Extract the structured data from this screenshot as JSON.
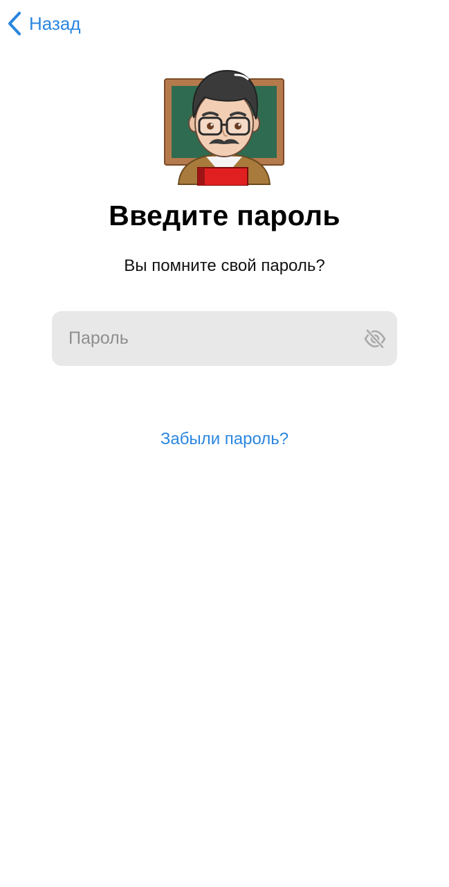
{
  "nav": {
    "back_label": "Назад",
    "back_icon": "chevron-left-icon"
  },
  "illustration": {
    "icon": "teacher-emoji"
  },
  "heading": {
    "title": "Введите пароль",
    "subtitle": "Вы помните свой пароль?"
  },
  "password": {
    "placeholder": "Пароль",
    "value": "",
    "toggle_icon": "eye-slash-icon"
  },
  "links": {
    "forgot_password": "Забыли пароль?"
  },
  "colors": {
    "accent": "#2a86df",
    "field_background": "#e8e8e8",
    "placeholder": "#8e8e8e",
    "background": "#ffffff"
  }
}
